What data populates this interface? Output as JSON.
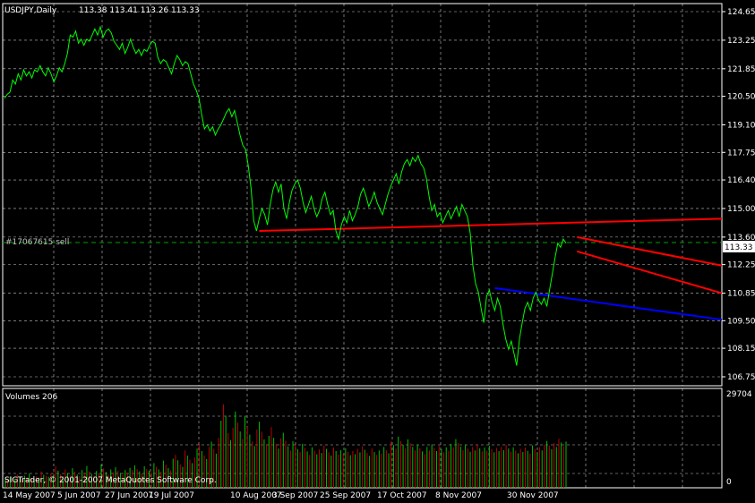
{
  "header": {
    "symbol": "USDJPY,Daily",
    "ohlc": "113.38 113.41 113.26 113.33"
  },
  "order_label": "#17067615 sell",
  "current_price": "113.33",
  "volumes_label": "Volumes 206",
  "copyright": "SIGTrader, © 2001-2007 MetaQuotes Software Corp.",
  "colors": {
    "background": "#000000",
    "grid": "#c0c0c0",
    "price_line": "#00ff00",
    "trend_red": "#ff0000",
    "trend_blue": "#0000ff",
    "volume_up": "#00c000",
    "volume_down": "#c00000",
    "axis_text": "#ffffff"
  },
  "chart_data": [
    {
      "type": "line",
      "title": "USDJPY,Daily",
      "ylim": [
        106.75,
        124.65
      ],
      "y_ticks": [
        "124.65",
        "123.25",
        "121.85",
        "120.50",
        "119.10",
        "117.75",
        "116.40",
        "115.00",
        "113.60",
        "112.25",
        "110.85",
        "109.50",
        "108.15",
        "106.75"
      ],
      "x_ticks": [
        "14 May 2007",
        "5 Jun 2007",
        "27 Jun 2007",
        "19 Jul 2007",
        "10 Aug 2007",
        "3 Sep 2007",
        "25 Sep 2007",
        "17 Oct 2007",
        "8 Nov 2007",
        "30 Nov 2007"
      ],
      "grid": true,
      "series": [
        {
          "values": [
            120.4,
            120.6,
            120.7,
            121.3,
            121.1,
            121.6,
            121.3,
            121.8,
            121.5,
            121.7,
            121.4,
            121.8,
            121.7,
            122.0,
            121.7,
            121.5,
            121.9,
            121.6,
            121.2,
            121.5,
            121.9,
            121.7,
            122.1,
            122.6,
            123.5,
            123.4,
            123.7,
            123.1,
            123.3,
            123.0,
            123.3,
            123.2,
            123.5,
            123.8,
            123.5,
            123.9,
            123.4,
            123.7,
            123.8,
            123.6,
            123.2,
            123.0,
            122.8,
            123.1,
            122.6,
            122.9,
            123.3,
            122.9,
            122.6,
            122.8,
            122.5,
            122.8,
            122.7,
            123.0,
            123.2,
            123.1,
            122.4,
            122.1,
            122.3,
            122.2,
            121.9,
            121.6,
            122.1,
            122.5,
            122.3,
            122.0,
            122.2,
            122.1,
            121.6,
            121.1,
            120.8,
            120.4,
            119.6,
            118.9,
            119.1,
            118.8,
            119.0,
            118.6,
            118.9,
            119.1,
            119.4,
            119.7,
            119.9,
            119.5,
            119.8,
            119.2,
            118.6,
            118.1,
            117.9,
            117.1,
            116.0,
            114.4,
            113.9,
            114.5,
            115.0,
            114.7,
            114.2,
            115.2,
            115.9,
            116.3,
            115.8,
            116.2,
            115.0,
            114.5,
            115.3,
            115.9,
            116.2,
            116.4,
            116.0,
            115.3,
            114.8,
            115.2,
            115.6,
            115.0,
            114.6,
            114.9,
            115.5,
            115.8,
            115.2,
            114.7,
            114.9,
            113.9,
            113.5,
            114.2,
            114.6,
            114.3,
            114.9,
            114.4,
            114.7,
            115.1,
            115.7,
            116.0,
            115.6,
            115.1,
            115.4,
            115.8,
            115.3,
            115.0,
            114.7,
            115.2,
            115.7,
            116.1,
            116.4,
            116.7,
            116.2,
            116.8,
            117.2,
            117.4,
            117.1,
            117.5,
            117.3,
            117.6,
            117.2,
            117.0,
            116.5,
            115.6,
            114.9,
            115.2,
            114.6,
            114.8,
            114.3,
            114.6,
            114.9,
            114.5,
            114.8,
            115.1,
            114.6,
            115.2,
            114.9,
            114.6,
            113.8,
            112.2,
            111.3,
            110.9,
            110.1,
            109.4,
            110.7,
            111.0,
            110.4,
            110.0,
            110.6,
            110.2,
            109.3,
            108.6,
            108.1,
            108.5,
            107.9,
            107.3,
            108.6,
            109.4,
            110.1,
            110.4,
            110.0,
            110.6,
            110.9,
            110.5,
            110.3,
            110.6,
            110.2,
            111.0,
            111.8,
            112.6,
            113.3,
            113.1,
            113.5,
            113.3
          ]
        }
      ],
      "annotations": [
        {
          "type": "hline",
          "name": "#17067615 sell",
          "y": 113.33
        },
        {
          "type": "trendline",
          "color": "red",
          "from": {
            "index": 93,
            "y": 113.9
          },
          "to": {
            "index": 270,
            "y": 114.5
          }
        },
        {
          "type": "trendline",
          "color": "red",
          "from": {
            "index": 209,
            "y": 113.6
          },
          "to": {
            "index": 270,
            "y": 112.2
          }
        },
        {
          "type": "trendline",
          "color": "red",
          "from": {
            "index": 209,
            "y": 112.9
          },
          "to": {
            "index": 270,
            "y": 110.85
          }
        },
        {
          "type": "trendline",
          "color": "blue",
          "from": {
            "index": 179,
            "y": 111.1
          },
          "to": {
            "index": 270,
            "y": 109.55
          }
        }
      ]
    },
    {
      "type": "bar",
      "title": "Volumes 206",
      "ylim": [
        0,
        29704
      ],
      "y_ticks": [
        "29704",
        "0"
      ],
      "series": [
        {
          "name": "Volumes",
          "values": [
            3200,
            2800,
            3600,
            3100,
            2900,
            4200,
            3400,
            2700,
            3800,
            3300,
            4500,
            3100,
            2900,
            3600,
            3200,
            5200,
            4100,
            3800,
            3500,
            4600,
            3900,
            6800,
            5400,
            4300,
            3600,
            5800,
            4700,
            3900,
            6200,
            5100,
            4200,
            3700,
            5600,
            4800,
            6900,
            5200,
            4400,
            3800,
            5300,
            4600,
            7400,
            6100,
            5000,
            4200,
            5800,
            4900,
            6500,
            5300,
            4700,
            4100,
            5600,
            4800,
            6300,
            5600,
            7100,
            5900,
            5200,
            4600,
            6800,
            6000,
            5400,
            4900,
            7800,
            6600,
            5800,
            5100,
            8600,
            7300,
            6200,
            5500,
            9200,
            10400,
            8700,
            7400,
            6600,
            11800,
            10200,
            8900,
            7800,
            9600,
            12400,
            13800,
            11600,
            10200,
            9100,
            12900,
            14600,
            12300,
            10800,
            15800,
            21200,
            26400,
            22800,
            17300,
            15100,
            18900,
            24100,
            20600,
            17800,
            15400,
            22700,
            19300,
            16800,
            14600,
            13200,
            18400,
            20900,
            17700,
            15300,
            13800,
            16400,
            19200,
            15800,
            13900,
            12400,
            15600,
            17400,
            14900,
            13100,
            11800,
            14700,
            13500,
            12200,
            11300,
            13900,
            12600,
            11500,
            10400,
            12800,
            11700,
            10600,
            12100,
            11000,
            13400,
            12300,
            11200,
            10200,
            12700,
            11600,
            10500,
            11900,
            10800,
            12500,
            11400,
            10300,
            11600,
            10600,
            12300,
            11200,
            13100,
            12000,
            11000,
            10100,
            12400,
            11300,
            10400,
            11800,
            10800,
            12900,
            11900,
            10900,
            14700,
            13500,
            12400,
            16200,
            14800,
            13600,
            12500,
            15300,
            14100,
            12900,
            11800,
            13600,
            12500,
            11500,
            10600,
            12900,
            11800,
            13700,
            12600,
            11600,
            13200,
            12200,
            11200,
            12800,
            11700,
            13900,
            12700,
            15400,
            14200,
            13000,
            11900,
            13500,
            12400,
            11400,
            12900,
            11800,
            13600,
            12500,
            11500,
            12700,
            11700,
            13300,
            12200,
            11200,
            12600,
            11600,
            12900,
            11900,
            13500,
            12400,
            11400,
            12800,
            11800,
            10900,
            12300,
            11300,
            12700,
            11700,
            10800,
            13400,
            12300,
            11300,
            12800,
            11800,
            13600,
            14800,
            13300,
            12200,
            14100,
            12900,
            15500,
            14300,
            13100,
            14600
          ]
        }
      ]
    }
  ]
}
